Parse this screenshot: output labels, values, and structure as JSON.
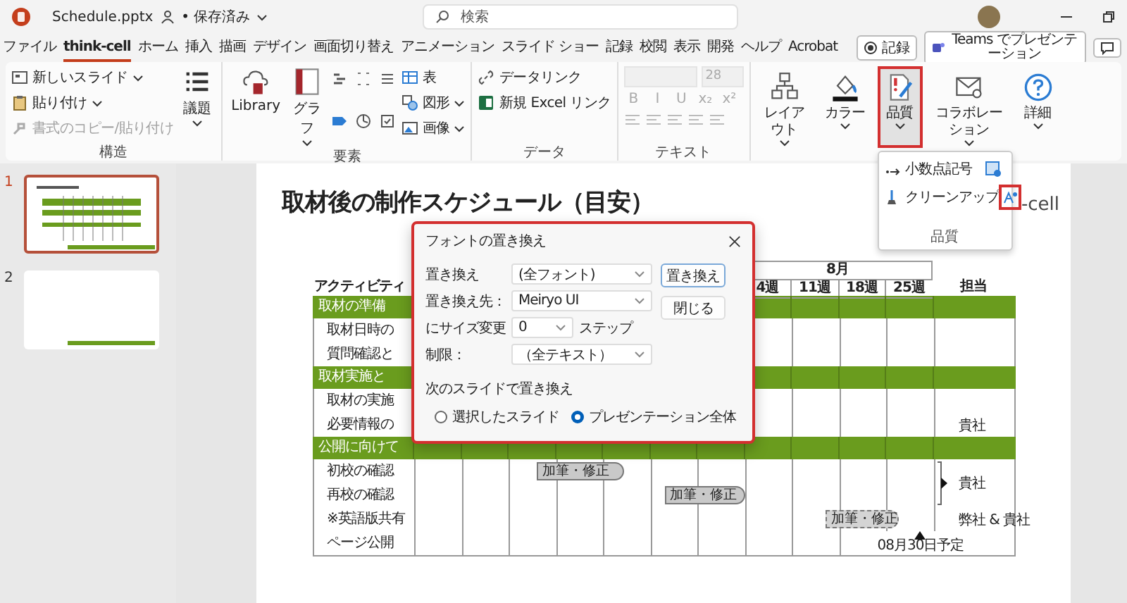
{
  "window": {
    "file_name": "Schedule.pptx",
    "save_status": "• 保存済み",
    "search_placeholder": "検索"
  },
  "tabs": [
    {
      "label": "ファイル",
      "selected": false
    },
    {
      "label": "think-cell",
      "selected": true
    },
    {
      "label": "ホーム",
      "selected": false
    },
    {
      "label": "挿入",
      "selected": false
    },
    {
      "label": "描画",
      "selected": false
    },
    {
      "label": "デザイン",
      "selected": false
    },
    {
      "label": "画面切り替え",
      "selected": false
    },
    {
      "label": "アニメーション",
      "selected": false
    },
    {
      "label": "スライド ショー",
      "selected": false
    },
    {
      "label": "記録",
      "selected": false
    },
    {
      "label": "校閲",
      "selected": false
    },
    {
      "label": "表示",
      "selected": false
    },
    {
      "label": "開発",
      "selected": false
    },
    {
      "label": "ヘルプ",
      "selected": false
    },
    {
      "label": "Acrobat",
      "selected": false
    }
  ],
  "record_button": "記録",
  "teams_button": "Teams でプレゼンテーション",
  "ribbon": {
    "structure": {
      "label": "構造",
      "new_slide": "新しいスライド",
      "paste": "貼り付け",
      "format_painter": {
        "label": "書式のコピー/貼り付け",
        "disabled": true
      },
      "agenda": "議題"
    },
    "elements": {
      "label": "要素",
      "library": "Library",
      "chart": "グラフ",
      "table": "表",
      "shapes": "図形",
      "image": "画像"
    },
    "data": {
      "label": "データ",
      "data_link": "データリンク",
      "excel_link": "新規 Excel リンク"
    },
    "text": {
      "label": "テキスト",
      "font_size": "28",
      "disabled": true,
      "format_buttons": [
        "B",
        "I",
        "U",
        "x₂",
        "x²"
      ]
    },
    "commands": [
      {
        "kind": "layout",
        "label": "レイアウト",
        "selected": false,
        "highlighted": false
      },
      {
        "kind": "color",
        "label": "カラー",
        "selected": false,
        "highlighted": false
      },
      {
        "kind": "quality",
        "label": "品質",
        "selected": true,
        "highlighted": true
      },
      {
        "kind": "collaboration",
        "label": "コラボレーション",
        "selected": false,
        "highlighted": false
      },
      {
        "kind": "help",
        "label": "詳細",
        "selected": false,
        "highlighted": false
      }
    ]
  },
  "quality_menu": {
    "items": [
      {
        "label": "小数点記号",
        "highlighted": false
      },
      {
        "label": "クリーンアップ",
        "highlighted": true
      }
    ],
    "group_label": "品質"
  },
  "slides": [
    {
      "number": "1",
      "selected": true
    },
    {
      "number": "2",
      "selected": false
    }
  ],
  "slide": {
    "title": "取材後の制作スケジュール（目安）",
    "logo": "-cell",
    "table": {
      "month": "8月",
      "activity_header": "アクティビティ",
      "owner_header": "担当",
      "weeks": [
        "4週",
        "11週",
        "18週",
        "25週"
      ],
      "sections": [
        {
          "title": "取材の準備",
          "rows": [
            {
              "activity": "取材日時の"
            },
            {
              "activity": "質問確認と"
            }
          ]
        },
        {
          "title": "取材実施と",
          "rows": [
            {
              "activity": "取材の実施"
            },
            {
              "activity": "必要情報の",
              "owner": {
                "label": "貴社",
                "kind": "plain"
              }
            }
          ]
        },
        {
          "title": "公開に向けて",
          "rows": [
            {
              "activity": "初校の確認",
              "owner": {
                "label": "貴社",
                "kind": "bracket"
              },
              "bar": {
                "label": "加筆・修正",
                "kind": "solid"
              }
            },
            {
              "activity": "再校の確認",
              "bar": {
                "label": "加筆・修正",
                "kind": "solid"
              }
            },
            {
              "activity": "※英語版共有",
              "owner": {
                "label": "弊社 & 貴社",
                "kind": "plain"
              },
              "bar": {
                "label": "加筆・修正",
                "kind": "dashed"
              }
            },
            {
              "activity": "ページ公開",
              "milestone": "08月30日予定"
            }
          ]
        }
      ]
    }
  },
  "dialog": {
    "title": "フォントの置き換え",
    "highlighted": true,
    "fields": [
      {
        "label": "置き換え",
        "value": "(全フォント)",
        "kind": "dropdown"
      },
      {
        "label": "置き換え先：",
        "value": "Meiryo UI",
        "kind": "dropdown"
      },
      {
        "label": "にサイズ変更",
        "value": "0",
        "kind": "spin",
        "suffix": "ステップ"
      },
      {
        "label": "制限：",
        "value": "（全テキスト）",
        "kind": "dropdown"
      }
    ],
    "buttons": [
      {
        "label": "置き換え",
        "default": true
      },
      {
        "label": "閉じる",
        "default": false
      }
    ],
    "scope_label": "次のスライドで置き換え",
    "scope_options": [
      {
        "label": "選択したスライド",
        "selected": false
      },
      {
        "label": "プレゼンテーション全体",
        "selected": true
      }
    ]
  }
}
